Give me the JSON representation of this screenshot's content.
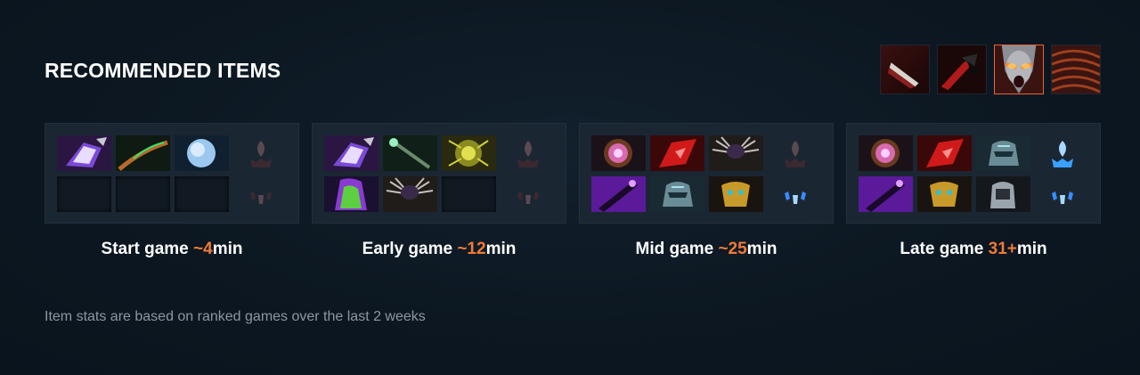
{
  "title": "RECOMMENDED ITEMS",
  "footnote": "Item stats are based on ranked games over the last 2 weeks",
  "colors": {
    "accent": "#f07a37",
    "panel": "#1b2633",
    "background": "#0c1621"
  },
  "portraits": [
    {
      "name": "ability-1-icon",
      "active": false
    },
    {
      "name": "ability-2-icon",
      "active": false
    },
    {
      "name": "hero-portrait-icon",
      "active": true
    },
    {
      "name": "ability-4-icon",
      "active": false
    }
  ],
  "stages": [
    {
      "label": "Start game",
      "time": "~4",
      "unit": "min",
      "items": [
        "purple-crystal-icon",
        "green-staff-icon",
        "blue-orb-icon",
        "",
        "",
        ""
      ],
      "aghanim_scepter": false,
      "aghanim_shard": false
    },
    {
      "label": "Early game",
      "time": "~12",
      "unit": "min",
      "items": [
        "purple-crystal-icon",
        "green-wand-icon",
        "yellow-orb-icon",
        "green-cloak-icon",
        "feather-helm-icon",
        ""
      ],
      "aghanim_scepter": false,
      "aghanim_shard": false
    },
    {
      "label": "Mid game",
      "time": "~25",
      "unit": "min",
      "items": [
        "pink-orb-icon",
        "red-crystal-icon",
        "feather-helm-icon",
        "purple-sword-icon",
        "steel-helm-icon",
        "gold-mask-icon"
      ],
      "aghanim_scepter": false,
      "aghanim_shard": true
    },
    {
      "label": "Late game",
      "time": "31+",
      "unit": "min",
      "items": [
        "pink-orb-icon",
        "red-crystal-icon",
        "steel-helm-icon",
        "purple-sword-icon",
        "gold-mask-icon",
        "silver-helm-icon"
      ],
      "aghanim_scepter": true,
      "aghanim_shard": true
    }
  ]
}
